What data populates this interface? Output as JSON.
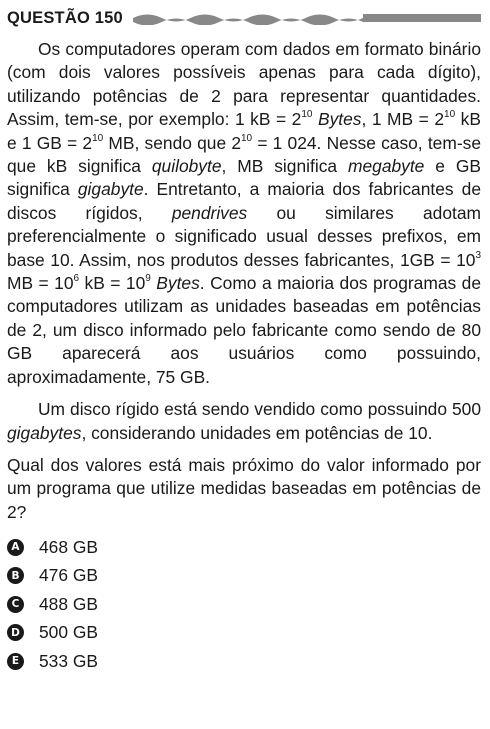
{
  "question": {
    "title": "QUESTÃO 150",
    "p1": {
      "t1": "Os computadores operam com dados em formato binário (com dois valores possíveis apenas para cada dígito), utilizando potências de 2 para representar quantidades. Assim, tem-se, por exemplo: 1 kB = 2",
      "e1": "10",
      "t2": "Bytes",
      "t3": ", 1 MB = 2",
      "e2": "10",
      "t4": " kB e 1 GB = 2",
      "e3": "10",
      "t5": " MB, sendo que 2",
      "e4": "10",
      "t6": " = 1 024. Nesse caso, tem-se que kB significa ",
      "i1": "quilobyte",
      "t7": ", MB significa ",
      "i2": "megabyte",
      "t8": " e GB significa ",
      "i3": "gigabyte",
      "t9": ". Entretanto, a maioria dos fabricantes de discos rígidos, ",
      "i4": "pendrives",
      "t10": " ou similares adotam preferencialmente o significado usual desses prefixos, em base 10. Assim, nos produtos desses fabricantes, 1GB = 10",
      "e5": "3",
      "t11": " MB = 10",
      "e6": "6",
      "t12": " kB = 10",
      "e7": "9",
      "i5": "Bytes",
      "t13": ". Como a maioria dos programas de computadores utilizam as unidades baseadas em potências de 2, um disco informado pelo fabricante como sendo de 80 GB aparecerá aos usuários como possuindo, aproximadamente, 75 GB."
    },
    "p2": {
      "t1": "Um disco rígido está sendo vendido como possuindo 500 ",
      "i1": "gigabytes",
      "t2": ", considerando unidades em potências de 10."
    },
    "p3": "Qual dos valores está mais próximo do valor informado por um programa que utilize medidas baseadas em potências de 2?",
    "options": [
      {
        "letter": "A",
        "text": "468 GB"
      },
      {
        "letter": "B",
        "text": "476 GB"
      },
      {
        "letter": "C",
        "text": "488 GB"
      },
      {
        "letter": "D",
        "text": "500 GB"
      },
      {
        "letter": "E",
        "text": "533 GB"
      }
    ]
  }
}
